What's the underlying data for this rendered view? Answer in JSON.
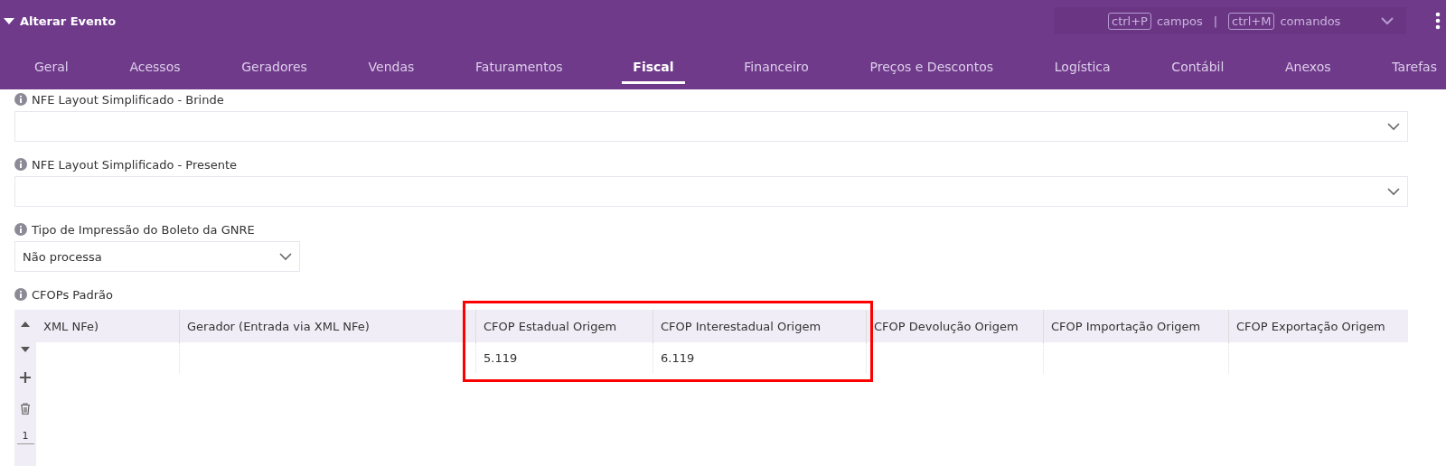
{
  "header": {
    "title": "Alterar Evento",
    "expanded": true,
    "shortcuts": [
      {
        "key": "ctrl+P",
        "label": "campos"
      },
      {
        "key": "ctrl+M",
        "label": "comandos"
      }
    ],
    "separator": "|"
  },
  "tabs": [
    {
      "label": "Geral",
      "selected": false
    },
    {
      "label": "Acessos",
      "selected": false
    },
    {
      "label": "Geradores",
      "selected": false
    },
    {
      "label": "Vendas",
      "selected": false
    },
    {
      "label": "Faturamentos",
      "selected": false
    },
    {
      "label": "Fiscal",
      "selected": true
    },
    {
      "label": "Financeiro",
      "selected": false
    },
    {
      "label": "Preços e Descontos",
      "selected": false
    },
    {
      "label": "Logística",
      "selected": false
    },
    {
      "label": "Contábil",
      "selected": false
    },
    {
      "label": "Anexos",
      "selected": false
    },
    {
      "label": "Tarefas",
      "selected": false
    }
  ],
  "fields": [
    {
      "label": "NFE Layout Simplificado - Brinde",
      "kind": "wide"
    },
    {
      "label": "NFE Layout Simplificado - Presente",
      "kind": "wide"
    },
    {
      "label": "Tipo de Impressão do Boleto da GNRE",
      "kind": "narrow",
      "value": "Não processa"
    }
  ],
  "table": {
    "label": "CFOPs Padrão",
    "page": "1",
    "columns": [
      {
        "title": "XML NFe)",
        "highlighted": false
      },
      {
        "title": "Gerador (Entrada via XML NFe)",
        "highlighted": false
      },
      {
        "title": "CFOP Estadual Origem",
        "highlighted": true
      },
      {
        "title": "CFOP Interestadual Origem",
        "highlighted": true
      },
      {
        "title": "CFOP Devolução Origem",
        "highlighted": false
      },
      {
        "title": "CFOP Importação Origem",
        "highlighted": false
      },
      {
        "title": "CFOP Exportação Origem",
        "highlighted": false
      }
    ],
    "rows": [
      [
        "",
        "",
        "5.119",
        "6.119",
        "",
        "",
        ""
      ]
    ]
  }
}
